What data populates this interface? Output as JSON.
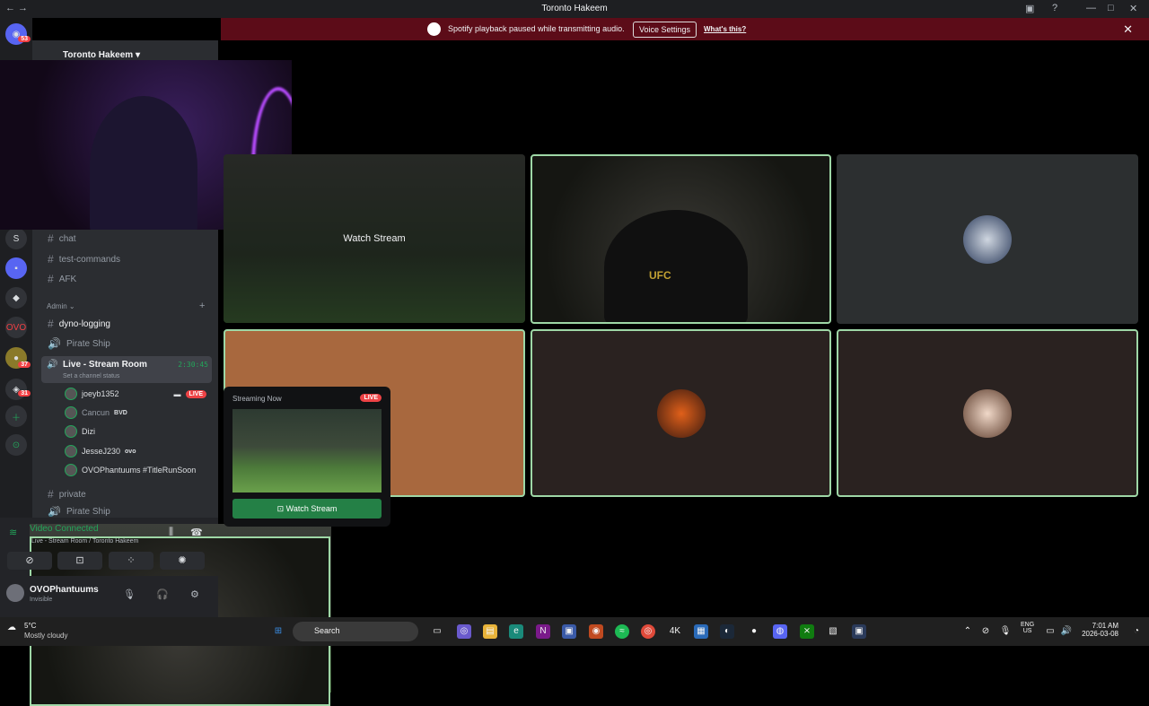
{
  "window": {
    "title": "Toronto Hakeem"
  },
  "banner": {
    "message": "Spotify playback paused while transmitting audio.",
    "button": "Voice Settings",
    "link": "What's this?"
  },
  "rail": {
    "badges": [
      "53",
      "37",
      "31"
    ]
  },
  "server": {
    "name": "Toronto Hakeem"
  },
  "channels": {
    "chat": "chat",
    "test_commands": "test-commands",
    "afk": "AFK",
    "admin": "Admin",
    "dyno": "dyno-logging",
    "pirate": "Pirate Ship",
    "stream_room": "Live - Stream Room",
    "status": "Set a channel status",
    "timer": "2:30:45",
    "private": "private",
    "pirate2": "Pirate Ship"
  },
  "users": [
    {
      "name": "joeyb1352",
      "live": "LIVE"
    },
    {
      "name": "Cancun",
      "tag": "BVD"
    },
    {
      "name": "Dizi"
    },
    {
      "name": "JesseJ230",
      "tag": "ovo"
    },
    {
      "name": "OVOPhantuums #TitleRunSoon"
    }
  ],
  "voice": {
    "status": "Video Connected",
    "channel": "Live - Stream Room / Toronto Hakeem"
  },
  "me": {
    "name": "OVOPhantuums",
    "status": "Invisible"
  },
  "stage": {
    "watch_stream": "Watch Stream",
    "ufc": "UFC"
  },
  "popup": {
    "title": "Streaming Now",
    "live": "LIVE",
    "button": "Watch Stream"
  },
  "taskbar": {
    "temp": "5°C",
    "weather": "Mostly cloudy",
    "search": "Search",
    "lang1": "ENG",
    "lang2": "US",
    "time": "7:01 AM",
    "date": "2026-03-08"
  }
}
